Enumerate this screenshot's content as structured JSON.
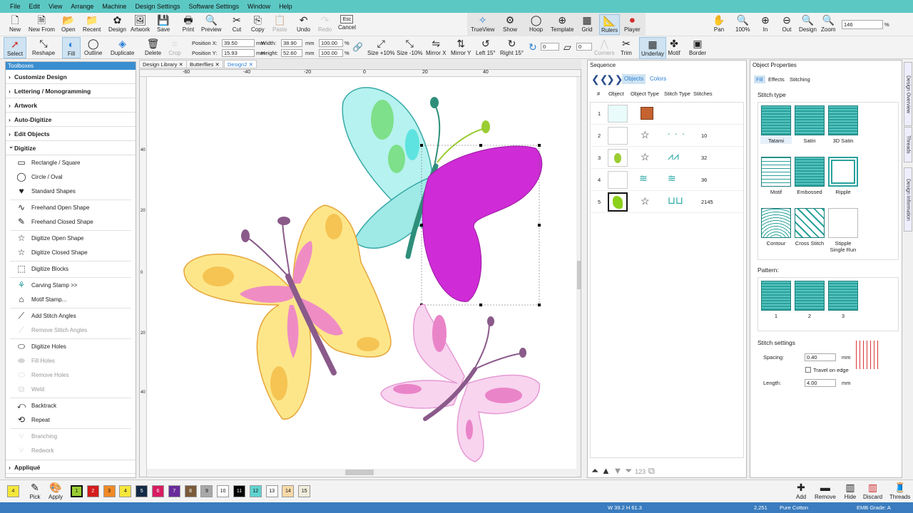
{
  "menu": [
    "File",
    "Edit",
    "View",
    "Arrange",
    "Machine",
    "Design Settings",
    "Software Settings",
    "Window",
    "Help"
  ],
  "toolbar1": [
    {
      "label": "New",
      "icon": "new-icon"
    },
    {
      "label": "New From",
      "icon": "new-from-icon"
    },
    {
      "label": "Open",
      "icon": "open-icon"
    },
    {
      "label": "Recent",
      "icon": "recent-icon"
    },
    {
      "label": "Design",
      "icon": "design-icon"
    },
    {
      "label": "Artwork",
      "icon": "artwork-icon"
    },
    {
      "label": "Save",
      "icon": "save-icon"
    },
    {
      "label": "Print",
      "icon": "print-icon"
    },
    {
      "label": "Preview",
      "icon": "preview-icon"
    },
    {
      "label": "Cut",
      "icon": "cut-icon"
    },
    {
      "label": "Copy",
      "icon": "copy-icon"
    },
    {
      "label": "Paste",
      "icon": "paste-icon"
    },
    {
      "label": "Undo",
      "icon": "undo-icon"
    },
    {
      "label": "Redo",
      "icon": "redo-icon"
    },
    {
      "label": "Cancel",
      "icon": "cancel-icon"
    },
    {
      "label": "TrueView",
      "icon": "trueview-icon"
    },
    {
      "label": "Show",
      "icon": "show-icon"
    },
    {
      "label": "Hoop",
      "icon": "hoop-icon"
    },
    {
      "label": "Template",
      "icon": "template-icon"
    },
    {
      "label": "Grid",
      "icon": "grid-icon"
    },
    {
      "label": "Rulers",
      "icon": "rulers-icon"
    },
    {
      "label": "Player",
      "icon": "player-icon"
    },
    {
      "label": "Pan",
      "icon": "pan-icon"
    },
    {
      "label": "100%",
      "icon": "zoom-100-icon"
    },
    {
      "label": "In",
      "icon": "zoom-in-icon"
    },
    {
      "label": "Out",
      "icon": "zoom-out-icon"
    },
    {
      "label": "Design",
      "icon": "zoom-design-icon"
    },
    {
      "label": "Zoom",
      "icon": "zoom-icon"
    }
  ],
  "esc_label": "Esc",
  "zoom_value": "146",
  "zoom_unit": "%",
  "toolbar2": [
    {
      "label": "Select"
    },
    {
      "label": "Reshape"
    },
    {
      "label": "Fill"
    },
    {
      "label": "Outline"
    },
    {
      "label": "Duplicate"
    },
    {
      "label": "Delete"
    },
    {
      "label": "Crop"
    },
    {
      "label": "Size +10%"
    },
    {
      "label": "Size -10%"
    },
    {
      "label": "Mirror X"
    },
    {
      "label": "Mirror Y"
    },
    {
      "label": "Left 15°"
    },
    {
      "label": "Right 15°"
    },
    {
      "label": "Corners"
    },
    {
      "label": "Trim"
    },
    {
      "label": "Underlay"
    },
    {
      "label": "Motif"
    },
    {
      "label": "Border"
    }
  ],
  "rotate_value": "0",
  "skew_value": "0",
  "position": {
    "x_label": "Position X:",
    "x_value": "39.50",
    "y_label": "Position Y:",
    "y_value": "15.93",
    "unit": "mm"
  },
  "size": {
    "w_label": "Width:",
    "w_value": "38.90",
    "h_label": "Height:",
    "h_value": "52.60",
    "unit": "mm",
    "w_pct": "100.00",
    "h_pct": "100.00",
    "pct": "%"
  },
  "toolbox": {
    "title": "Toolboxes",
    "categories": [
      "Customize Design",
      "Lettering / Monogramming",
      "Artwork",
      "Auto-Digitize",
      "Edit Objects",
      "Digitize"
    ],
    "items": [
      "Rectangle / Square",
      "Circle / Oval",
      "Standard Shapes",
      "Freehand Open Shape",
      "Freehand Closed Shape",
      "Digitize Open Shape",
      "Digitize Closed Shape",
      "Digitize Blocks",
      "Carving Stamp >>",
      "Motif Stamp...",
      "Add Stitch Angles",
      "Remove Stitch Angles",
      "Digitize Holes",
      "Fill Holes",
      "Remove Holes",
      "Weld",
      "Backtrack",
      "Repeat",
      "Branching",
      "Redwork"
    ],
    "applique": "Appliqué"
  },
  "doc_tabs": [
    "Design Library",
    "Butterflies",
    "Design2"
  ],
  "rulers": {
    "h": [
      "-60",
      "-40",
      "-20",
      "0",
      "20",
      "40"
    ],
    "v": [
      "40",
      "20",
      "0",
      "20",
      "40"
    ]
  },
  "sequence": {
    "title": "Sequence",
    "tabs": [
      "Objects",
      "Colors"
    ],
    "columns": [
      "#",
      "Object",
      "Object Type",
      "Stitch Type",
      "Stitches"
    ],
    "rows": [
      {
        "n": "1",
        "stitches": ""
      },
      {
        "n": "2",
        "stitches": "10"
      },
      {
        "n": "3",
        "stitches": "32"
      },
      {
        "n": "4",
        "stitches": "36"
      },
      {
        "n": "5",
        "stitches": "2145"
      }
    ]
  },
  "props": {
    "title": "Object Properties",
    "tabs": [
      "Fill",
      "Effects",
      "Stitching"
    ],
    "stitch_type_label": "Stitch type",
    "stitch_types": [
      "Tatami",
      "Satin",
      "3D Satin",
      "Motif",
      "Embossed",
      "Ripple",
      "Contour",
      "Cross Stitch",
      "Stipple Single Run"
    ],
    "pattern_label": "Pattern:",
    "patterns": [
      "1",
      "2",
      "3"
    ],
    "settings_label": "Stitch settings",
    "spacing_label": "Spacing:",
    "spacing_value": "0.40",
    "travel_label": "Travel on edge",
    "length_label": "Length:",
    "length_value": "4.00",
    "unit": "mm"
  },
  "side_tabs": [
    "Design Overview",
    "Threads",
    "Design Information"
  ],
  "palette": {
    "colors": [
      {
        "n": "4",
        "bg": "#f5e63b"
      },
      {
        "n": "1",
        "bg": "#9acd32"
      },
      {
        "n": "2",
        "bg": "#d41c1c"
      },
      {
        "n": "3",
        "bg": "#f08a24"
      },
      {
        "n": "4",
        "bg": "#f5e63b"
      },
      {
        "n": "5",
        "bg": "#132a46"
      },
      {
        "n": "6",
        "bg": "#d81b60"
      },
      {
        "n": "7",
        "bg": "#6a2b9a"
      },
      {
        "n": "8",
        "bg": "#7a5a3a"
      },
      {
        "n": "9",
        "bg": "#a8a8a8"
      },
      {
        "n": "10",
        "bg": "#ffffff"
      },
      {
        "n": "11",
        "bg": "#000000"
      },
      {
        "n": "12",
        "bg": "#5fd3d0"
      },
      {
        "n": "13",
        "bg": "#fafafa"
      },
      {
        "n": "14",
        "bg": "#f7d9a8"
      },
      {
        "n": "15",
        "bg": "#f0eddc"
      }
    ],
    "pick": "Pick",
    "apply": "Apply",
    "right": [
      "Add",
      "Remove",
      "Hide",
      "Discard",
      "Threads"
    ]
  },
  "status": {
    "dims": "W 39.2 H 61.3",
    "stitches": "2,251",
    "fabric": "Pure Cotton",
    "grade": "EMB Grade: A"
  }
}
